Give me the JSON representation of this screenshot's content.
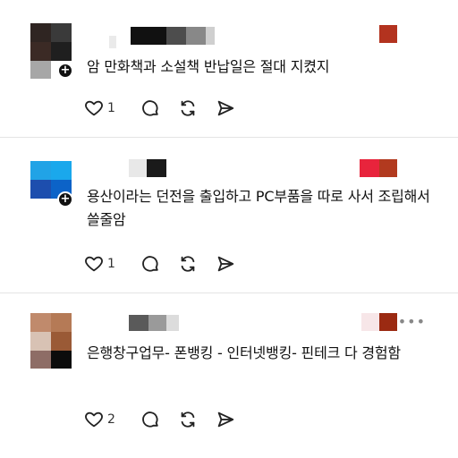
{
  "posts": [
    {
      "text": "암 만화책과 소설책 반납일은 절대 지켰지",
      "likes": "1"
    },
    {
      "text": "용산이라는 던전을 출입하고 PC부품을 따로 사서 조립해서 쓸줄암",
      "likes": "1"
    },
    {
      "text": "은행창구업무- 폰뱅킹 - 인터넷뱅킹- 핀테크 다 경험함",
      "likes": "2"
    }
  ],
  "icons": {
    "like": "heart-icon",
    "reply": "comment-icon",
    "repost": "repost-icon",
    "share": "send-icon",
    "follow": "plus-icon",
    "more": "more-icon"
  },
  "more_label": "•••"
}
